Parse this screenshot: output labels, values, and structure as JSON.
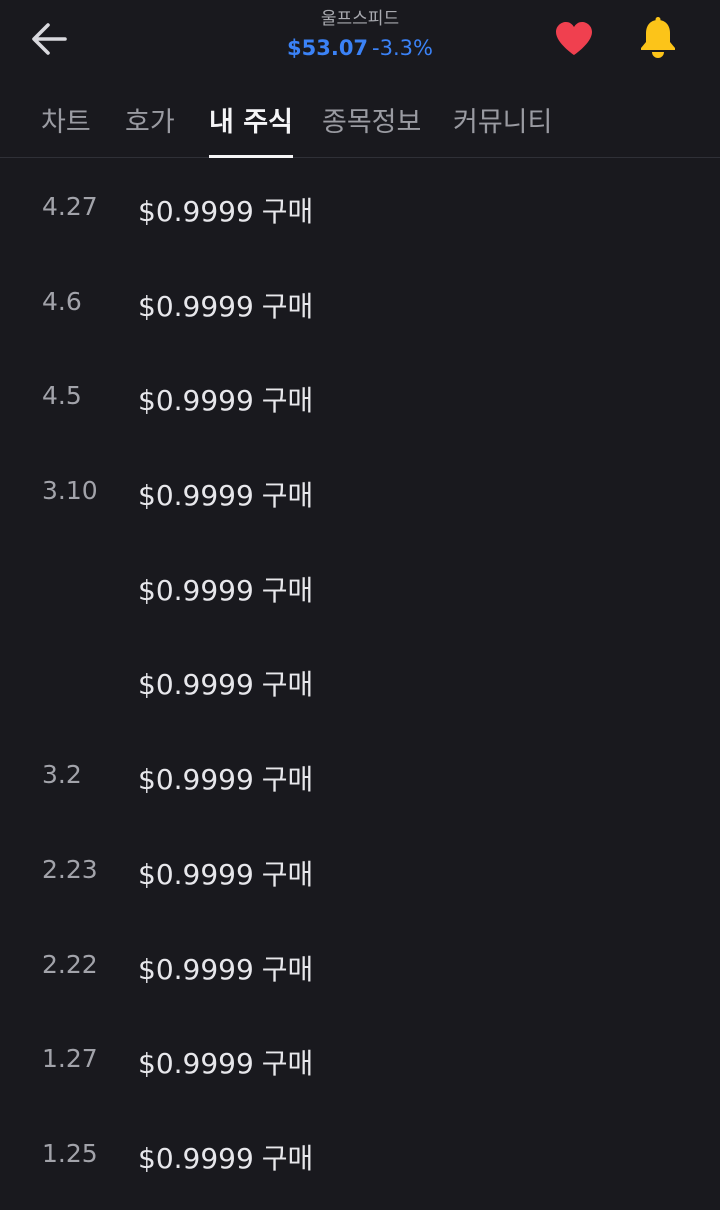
{
  "header": {
    "stock_name": "울프스피드",
    "price": "$53.07",
    "change": "-3.3%",
    "back_icon": "arrow-left-icon",
    "favorite_icon": "heart-icon",
    "favorite_color": "#f0404f",
    "alert_icon": "bell-icon",
    "alert_color": "#fcc419",
    "price_color": "#3b82f6"
  },
  "tabs": [
    {
      "label": "차트",
      "active": false
    },
    {
      "label": "호가",
      "active": false
    },
    {
      "label": "내 주식",
      "active": true
    },
    {
      "label": "종목정보",
      "active": false
    },
    {
      "label": "커뮤니티",
      "active": false
    }
  ],
  "transactions": [
    {
      "date": "4.27",
      "amount": "$0.9999",
      "type": "구매"
    },
    {
      "date": "4.6",
      "amount": "$0.9999",
      "type": "구매"
    },
    {
      "date": "4.5",
      "amount": "$0.9999",
      "type": "구매"
    },
    {
      "date": "3.10",
      "amount": "$0.9999",
      "type": "구매"
    },
    {
      "date": "",
      "amount": "$0.9999",
      "type": "구매"
    },
    {
      "date": "",
      "amount": "$0.9999",
      "type": "구매"
    },
    {
      "date": "3.2",
      "amount": "$0.9999",
      "type": "구매"
    },
    {
      "date": "2.23",
      "amount": "$0.9999",
      "type": "구매"
    },
    {
      "date": "2.22",
      "amount": "$0.9999",
      "type": "구매"
    },
    {
      "date": "1.27",
      "amount": "$0.9999",
      "type": "구매"
    },
    {
      "date": "1.25",
      "amount": "$0.9999",
      "type": "구매"
    }
  ]
}
